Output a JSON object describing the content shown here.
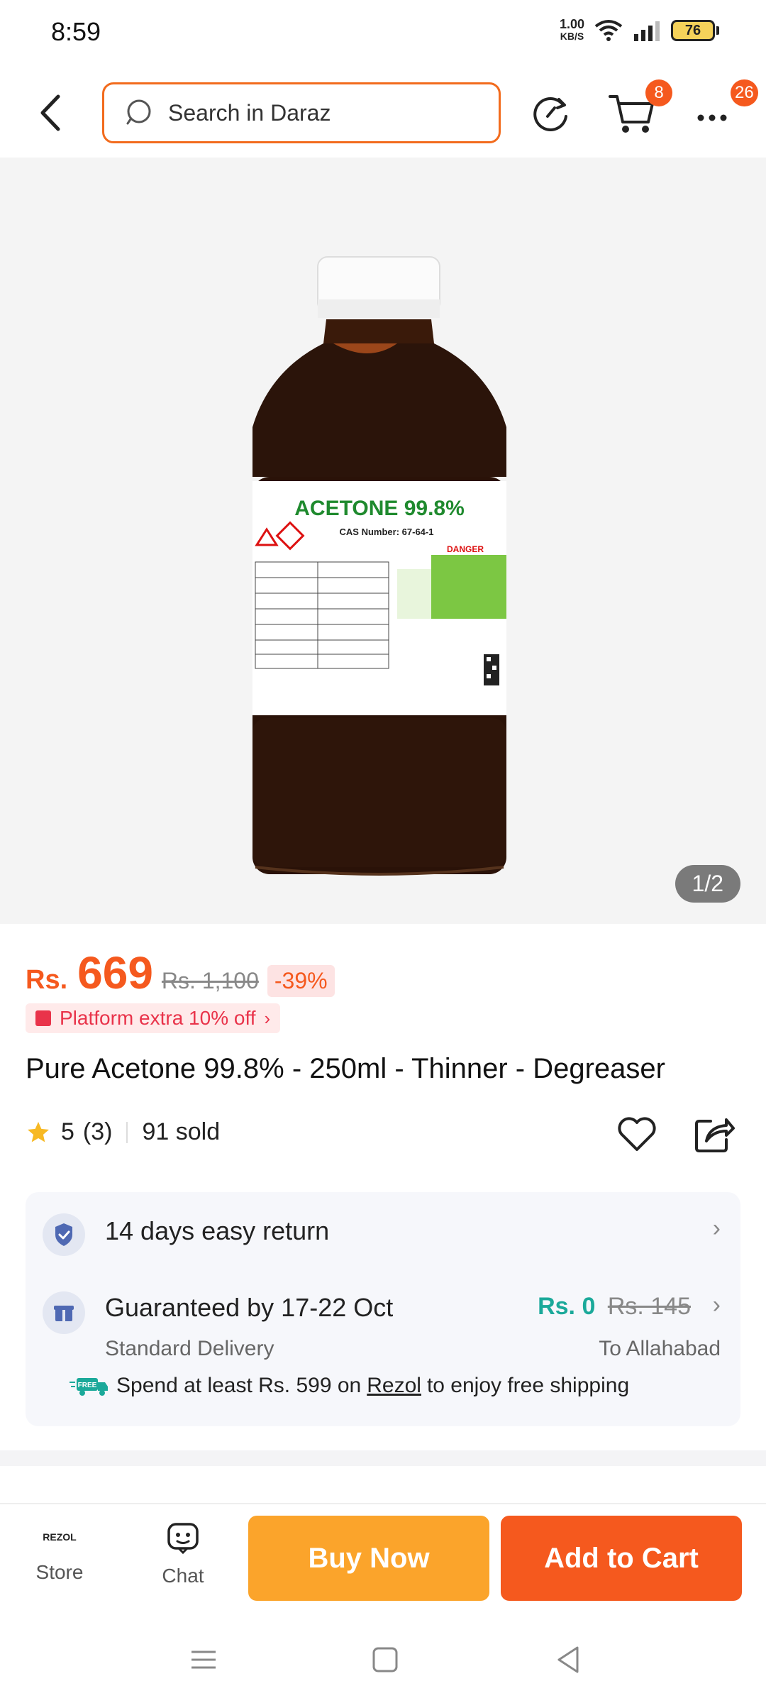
{
  "status_bar": {
    "time": "8:59",
    "net_speed_value": "1.00",
    "net_speed_unit": "KB/S",
    "battery": "76"
  },
  "nav": {
    "search_placeholder": "Search in Daraz",
    "cart_badge": "8",
    "more_badge": "26"
  },
  "gallery": {
    "page_indicator": "1/2",
    "label_title": "ACETONE 99.8%",
    "label_cas": "CAS Number: 67-64-1",
    "label_danger": "DANGER"
  },
  "product": {
    "currency": "Rs.",
    "price": "669",
    "old_price": "Rs. 1,100",
    "discount": "-39%",
    "promo": "Platform extra 10% off",
    "title": "Pure Acetone 99.8% - 250ml - Thinner - Degreaser",
    "rating": "5",
    "rating_count": "(3)",
    "sold": "91 sold"
  },
  "delivery": {
    "return_text": "14 days easy return",
    "guarantee_text": "Guaranteed by 17-22 Oct",
    "shipping_new": "Rs. 0",
    "shipping_old": "Rs. 145",
    "delivery_type": "Standard Delivery",
    "destination": "To Allahabad",
    "promo_prefix": "Spend at least Rs. 599 on",
    "promo_store": "Rezol",
    "promo_suffix": "to enjoy free shipping",
    "free_tag": "FREE"
  },
  "bottom_bar": {
    "store_logo": "REZOL",
    "store_label": "Store",
    "chat_label": "Chat",
    "buy_now": "Buy Now",
    "add_to_cart": "Add to Cart"
  },
  "colors": {
    "accent": "#f5591e",
    "buy_now": "#fba42b",
    "teal": "#1ba99a"
  }
}
